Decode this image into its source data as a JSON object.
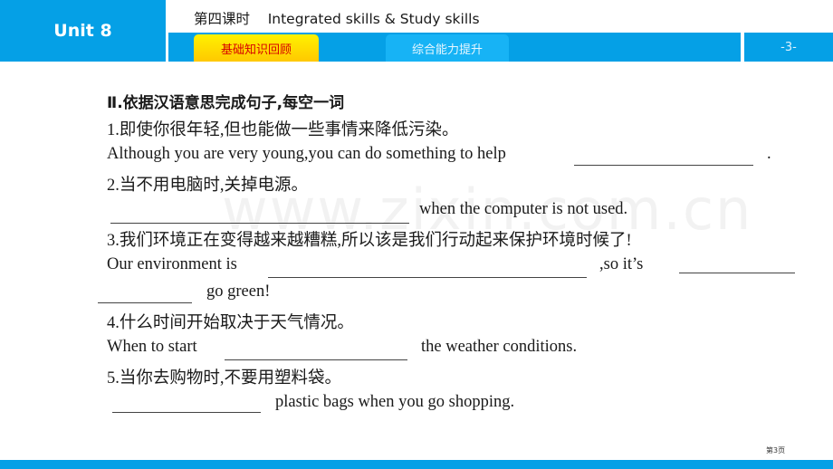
{
  "header": {
    "unit": "Unit 8",
    "title": "第四课时    Integrated skills & Study skills",
    "tabs": [
      {
        "label": "基础知识回顾",
        "active": true
      },
      {
        "label": "综合能力提升",
        "active": false
      }
    ],
    "page_indicator": "-3-"
  },
  "section": {
    "heading": "Ⅱ.依据汉语意思完成句子,每空一词",
    "items": [
      {
        "cn": "1.即使你很年轻,但也能做一些事情来降低污染。",
        "en_before": "Although you are very young,you can do something to help",
        "en_after": "."
      },
      {
        "cn": "2.当不用电脑时,关掉电源。",
        "en_after": "when the computer is not used."
      },
      {
        "cn": "3.我们环境正在变得越来越糟糕,所以该是我们行动起来保护环境时候了!",
        "en_before": "Our environment is",
        "en_mid": ",so it’s",
        "en_after": "go green!"
      },
      {
        "cn": "4.什么时间开始取决于天气情况。",
        "en_before": "When to start",
        "en_after": "the weather conditions."
      },
      {
        "cn": "5.当你去购物时,不要用塑料袋。",
        "en_after": "plastic bags when you go shopping."
      }
    ]
  },
  "watermark": "www.zixin.com.cn",
  "footer": {
    "page_label": "第3页"
  },
  "colors": {
    "brand_blue": "#05a0e6",
    "active_tab_text": "#d60000",
    "active_tab_bg": "#ffd800"
  }
}
